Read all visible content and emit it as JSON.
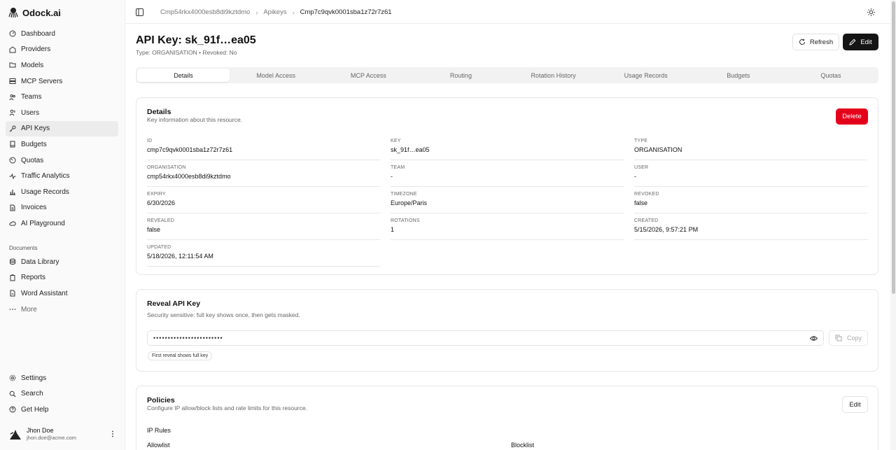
{
  "app": {
    "name": "Odock.ai"
  },
  "sidebar": {
    "items": [
      {
        "label": "Dashboard",
        "icon": "dashboard-icon"
      },
      {
        "label": "Providers",
        "icon": "providers-icon"
      },
      {
        "label": "Models",
        "icon": "folder-icon"
      },
      {
        "label": "MCP Servers",
        "icon": "server-icon"
      },
      {
        "label": "Teams",
        "icon": "teams-icon"
      },
      {
        "label": "Users",
        "icon": "users-icon"
      },
      {
        "label": "API Keys",
        "icon": "key-icon"
      },
      {
        "label": "Budgets",
        "icon": "book-icon"
      },
      {
        "label": "Quotas",
        "icon": "gauge-icon"
      },
      {
        "label": "Traffic Analytics",
        "icon": "activity-icon"
      },
      {
        "label": "Usage Records",
        "icon": "bar-chart-icon"
      },
      {
        "label": "Invoices",
        "icon": "file-text-icon"
      },
      {
        "label": "AI Playground",
        "icon": "cloud-icon"
      }
    ],
    "group_label": "Documents",
    "documents": [
      {
        "label": "Data Library",
        "icon": "database-icon"
      },
      {
        "label": "Reports",
        "icon": "clipboard-icon"
      },
      {
        "label": "Word Assistant",
        "icon": "file-icon"
      },
      {
        "label": "More",
        "icon": "more-icon"
      }
    ],
    "bottom": [
      {
        "label": "Settings",
        "icon": "gear-icon"
      },
      {
        "label": "Search",
        "icon": "search-icon"
      },
      {
        "label": "Get Help",
        "icon": "help-icon"
      }
    ],
    "user": {
      "name": "Jhon Doe",
      "email": "jhon.doe@acme.com"
    }
  },
  "breadcrumb": {
    "items": [
      "Cmp54rkx4000esb8di9kztdmo",
      "Apikeys",
      "Cmp7c9qvk0001sba1z72r7z61"
    ],
    "separator": "›"
  },
  "header": {
    "title": "API Key: sk_91f…ea05",
    "subtitle": "Type: ORGANISATION • Revoked: No",
    "refresh_label": "Refresh",
    "edit_label": "Edit"
  },
  "tabs": [
    "Details",
    "Model Access",
    "MCP Access",
    "Routing",
    "Rotation History",
    "Usage Records",
    "Budgets",
    "Quotas"
  ],
  "details": {
    "title": "Details",
    "description": "Key information about this resource.",
    "delete_label": "Delete",
    "fields": [
      {
        "label": "ID",
        "value": "cmp7c9qvk0001sba1z72r7z61"
      },
      {
        "label": "Key",
        "value": "sk_91f…ea05"
      },
      {
        "label": "Type",
        "value": "ORGANISATION"
      },
      {
        "label": "Organisation",
        "value": "cmp54rkx4000esb8di9kztdmo"
      },
      {
        "label": "Team",
        "value": "-"
      },
      {
        "label": "User",
        "value": "-"
      },
      {
        "label": "Expiry",
        "value": "6/30/2026"
      },
      {
        "label": "Timezone",
        "value": "Europe/Paris"
      },
      {
        "label": "Revoked",
        "value": "false"
      },
      {
        "label": "Revealed",
        "value": "false"
      },
      {
        "label": "Rotations",
        "value": "1"
      },
      {
        "label": "Created",
        "value": "5/15/2026, 9:57:21 PM"
      },
      {
        "label": "Updated",
        "value": "5/18/2026, 12:11:54 AM"
      }
    ]
  },
  "reveal": {
    "title": "Reveal API Key",
    "description": "Security sensitive: full key shows once, then gets masked.",
    "masked_value": "••••••••••••••••••••••••",
    "copy_label": "Copy",
    "note": "First reveal shows full key"
  },
  "policies": {
    "title": "Policies",
    "description": "Configure IP allow/block lists and rate limits for this resource.",
    "edit_label": "Edit",
    "ip_rules_label": "IP Rules",
    "allowlist_label": "Allowlist",
    "blocklist_label": "Blocklist"
  },
  "colors": {
    "accent_dark": "#141414",
    "danger": "#e4001b",
    "active_nav": "#ececec"
  }
}
